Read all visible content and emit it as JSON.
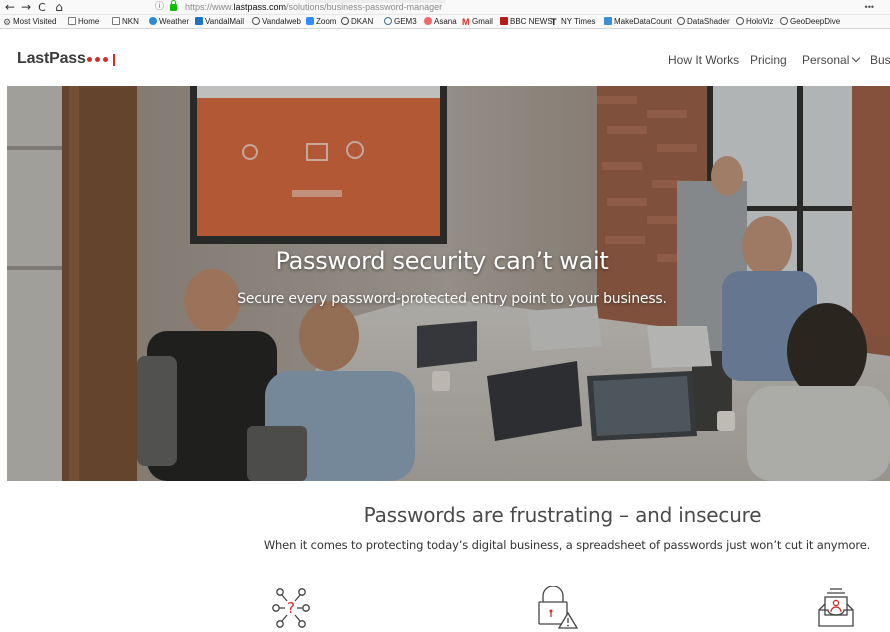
{
  "browser": {
    "nav": {
      "back_glyph": "←",
      "forward_glyph": "→",
      "reload_glyph": "C",
      "home_glyph": "⌂"
    },
    "url_prefix": "https://www.",
    "url_domain": "lastpass.com",
    "url_path": "/solutions/business-password-manager",
    "url_info_glyph": "ⓘ",
    "url_menu_glyph": "•••",
    "bookmarks": [
      {
        "label": "Most Visited",
        "icon": "gear-icon",
        "color": "#6a6a6a"
      },
      {
        "label": "Home",
        "icon": "folder-icon",
        "color": "#7a7a7a"
      },
      {
        "label": "NKN",
        "icon": "folder-icon",
        "color": "#7a7a7a"
      },
      {
        "label": "Weather",
        "icon": "weather-icon",
        "color": "#2a8ad6"
      },
      {
        "label": "VandalMail",
        "icon": "mail-icon",
        "color": "#1e73c9"
      },
      {
        "label": "Vandalweb",
        "icon": "globe-icon",
        "color": "#555555"
      },
      {
        "label": "Zoom",
        "icon": "zoom-icon",
        "color": "#2d8cff"
      },
      {
        "label": "DKAN",
        "icon": "dkan-icon",
        "color": "#444444"
      },
      {
        "label": "GEM3",
        "icon": "gem-icon",
        "color": "#3a6ea5"
      },
      {
        "label": "Asana",
        "icon": "asana-icon",
        "color": "#f06a6a"
      },
      {
        "label": "Gmail",
        "icon": "gmail-icon",
        "color": "#d93025"
      },
      {
        "label": "BBC NEWS",
        "icon": "bbc-icon",
        "color": "#bb1919"
      },
      {
        "label": "NY Times",
        "icon": "nyt-icon",
        "color": "#111111"
      },
      {
        "label": "MakeDataCount",
        "icon": "chart-icon",
        "color": "#3a8fd6"
      },
      {
        "label": "DataShader",
        "icon": "globe-icon",
        "color": "#555555"
      },
      {
        "label": "HoloViz",
        "icon": "globe-icon",
        "color": "#555555"
      },
      {
        "label": "GeoDeepDive",
        "icon": "globe-icon",
        "color": "#555555"
      }
    ]
  },
  "header": {
    "logo_text": "LastPass",
    "nav": [
      "How It Works",
      "Pricing",
      "Personal",
      "Busi"
    ],
    "accent": "#d32d27"
  },
  "hero": {
    "title": "Password security can’t wait",
    "subtitle": "Secure every password-protected entry point to your business."
  },
  "section": {
    "title": "Passwords are frustrating – and insecure",
    "subtitle": "When it comes to protecting today’s digital business, a spreadsheet of passwords just won’t cut it anymore."
  },
  "features": [
    {
      "icon": "network-question-icon"
    },
    {
      "icon": "lock-warning-icon"
    },
    {
      "icon": "inbox-user-icon"
    }
  ]
}
